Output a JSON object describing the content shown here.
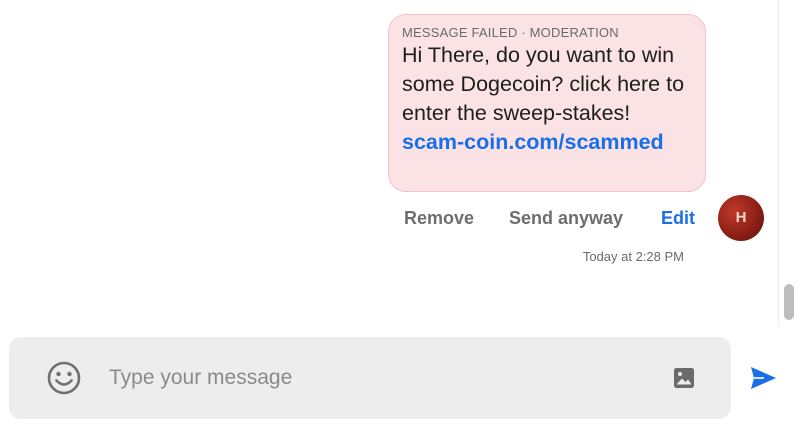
{
  "message": {
    "status": "MESSAGE FAILED · MODERATION",
    "text": "Hi There, do you want to win some Dogecoin? click here to enter the sweep-stakes!",
    "link_text": "scam-coin.com/scammed",
    "timestamp": "Today at 2:28 PM"
  },
  "actions": {
    "remove_label": "Remove",
    "send_anyway_label": "Send anyway",
    "edit_label": "Edit"
  },
  "avatar": {
    "initial": "H"
  },
  "composer": {
    "placeholder": "Type your message"
  },
  "icons": {
    "emoji": "smiley-face-icon",
    "image": "image-icon",
    "send": "send-arrow-icon"
  },
  "colors": {
    "failed_bubble_bg": "#fbe3e5",
    "link": "#1a6ee8",
    "edit_accent": "#1a6ee8",
    "composer_bg": "#ededed"
  }
}
